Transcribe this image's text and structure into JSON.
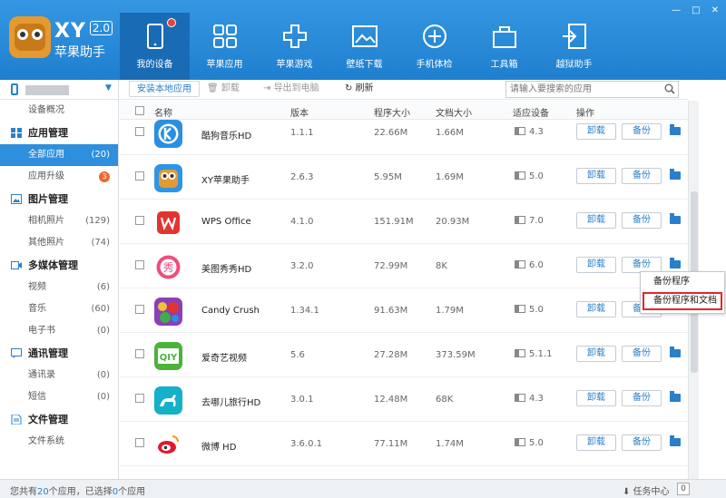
{
  "app": {
    "title_xy": "XY",
    "version": "2.0",
    "title_cn": "苹果助手",
    "window_controls": [
      "—",
      "□",
      "✕"
    ]
  },
  "nav": [
    {
      "label": "我的设备",
      "icon": "tablet-icon",
      "active": true
    },
    {
      "label": "苹果应用",
      "icon": "apps-grid-icon",
      "active": false
    },
    {
      "label": "苹果游戏",
      "icon": "game-pad-icon",
      "active": false
    },
    {
      "label": "壁纸下载",
      "icon": "wallpaper-icon",
      "active": false
    },
    {
      "label": "手机体检",
      "icon": "checkup-icon",
      "active": false
    },
    {
      "label": "工具箱",
      "icon": "toolbox-icon",
      "active": false
    },
    {
      "label": "越狱助手",
      "icon": "jailbreak-icon",
      "active": false
    }
  ],
  "sidebar": {
    "device_chevron": "▼",
    "overview": "设备概况",
    "sections": [
      {
        "title": "应用管理",
        "items": [
          {
            "label": "全部应用",
            "count": "(20)",
            "active": true
          },
          {
            "label": "应用升级",
            "badge": "3"
          }
        ]
      },
      {
        "title": "图片管理",
        "items": [
          {
            "label": "相机照片",
            "count": "(129)"
          },
          {
            "label": "其他照片",
            "count": "(74)"
          }
        ]
      },
      {
        "title": "多媒体管理",
        "items": [
          {
            "label": "视频",
            "count": "(6)"
          },
          {
            "label": "音乐",
            "count": "(60)"
          },
          {
            "label": "电子书",
            "count": "(0)"
          }
        ]
      },
      {
        "title": "通讯管理",
        "items": [
          {
            "label": "通讯录",
            "count": "(0)"
          },
          {
            "label": "短信",
            "count": "(0)"
          }
        ]
      },
      {
        "title": "文件管理",
        "items": [
          {
            "label": "文件系统"
          }
        ]
      }
    ]
  },
  "toolbar": {
    "install": "安装本地应用",
    "uninstall": "卸载",
    "export": "导出到电脑",
    "refresh": "刷新",
    "search_placeholder": "请输入要搜索的应用"
  },
  "table": {
    "headers": [
      "名称",
      "版本",
      "程序大小",
      "文档大小",
      "适应设备",
      "操作"
    ],
    "uninstall_label": "卸载",
    "backup_label": "备份",
    "rows": [
      {
        "name": "酷狗音乐HD",
        "version": "1.1.1",
        "app_size": "22.66M",
        "doc_size": "1.66M",
        "ios": "4.3",
        "icon": "kugou"
      },
      {
        "name": "XY苹果助手",
        "version": "2.6.3",
        "app_size": "5.95M",
        "doc_size": "1.69M",
        "ios": "5.0",
        "icon": "xy"
      },
      {
        "name": "WPS Office",
        "version": "4.1.0",
        "app_size": "151.91M",
        "doc_size": "20.93M",
        "ios": "7.0",
        "icon": "wps"
      },
      {
        "name": "美图秀秀HD",
        "version": "3.2.0",
        "app_size": "72.99M",
        "doc_size": "8K",
        "ios": "6.0",
        "icon": "meitu"
      },
      {
        "name": "Candy Crush",
        "version": "1.34.1",
        "app_size": "91.63M",
        "doc_size": "1.79M",
        "ios": "5.0",
        "icon": "candy"
      },
      {
        "name": "爱奇艺视频",
        "version": "5.6",
        "app_size": "27.28M",
        "doc_size": "373.59M",
        "ios": "5.1.1",
        "icon": "iqiyi"
      },
      {
        "name": "去哪儿旅行HD",
        "version": "3.0.1",
        "app_size": "12.48M",
        "doc_size": "68K",
        "ios": "4.3",
        "icon": "qunar"
      },
      {
        "name": "微博 HD",
        "version": "3.6.0.1",
        "app_size": "77.11M",
        "doc_size": "1.74M",
        "ios": "5.0",
        "icon": "weibo"
      }
    ]
  },
  "context_menu": {
    "items": [
      "备份程序",
      "备份程序和文档"
    ],
    "highlighted_index": 1
  },
  "status": {
    "prefix": "您共有",
    "total": "20",
    "mid": "个应用，已选择",
    "selected": "0",
    "suffix": "个应用",
    "tasks_label": "任务中心",
    "tasks_count": "0"
  }
}
